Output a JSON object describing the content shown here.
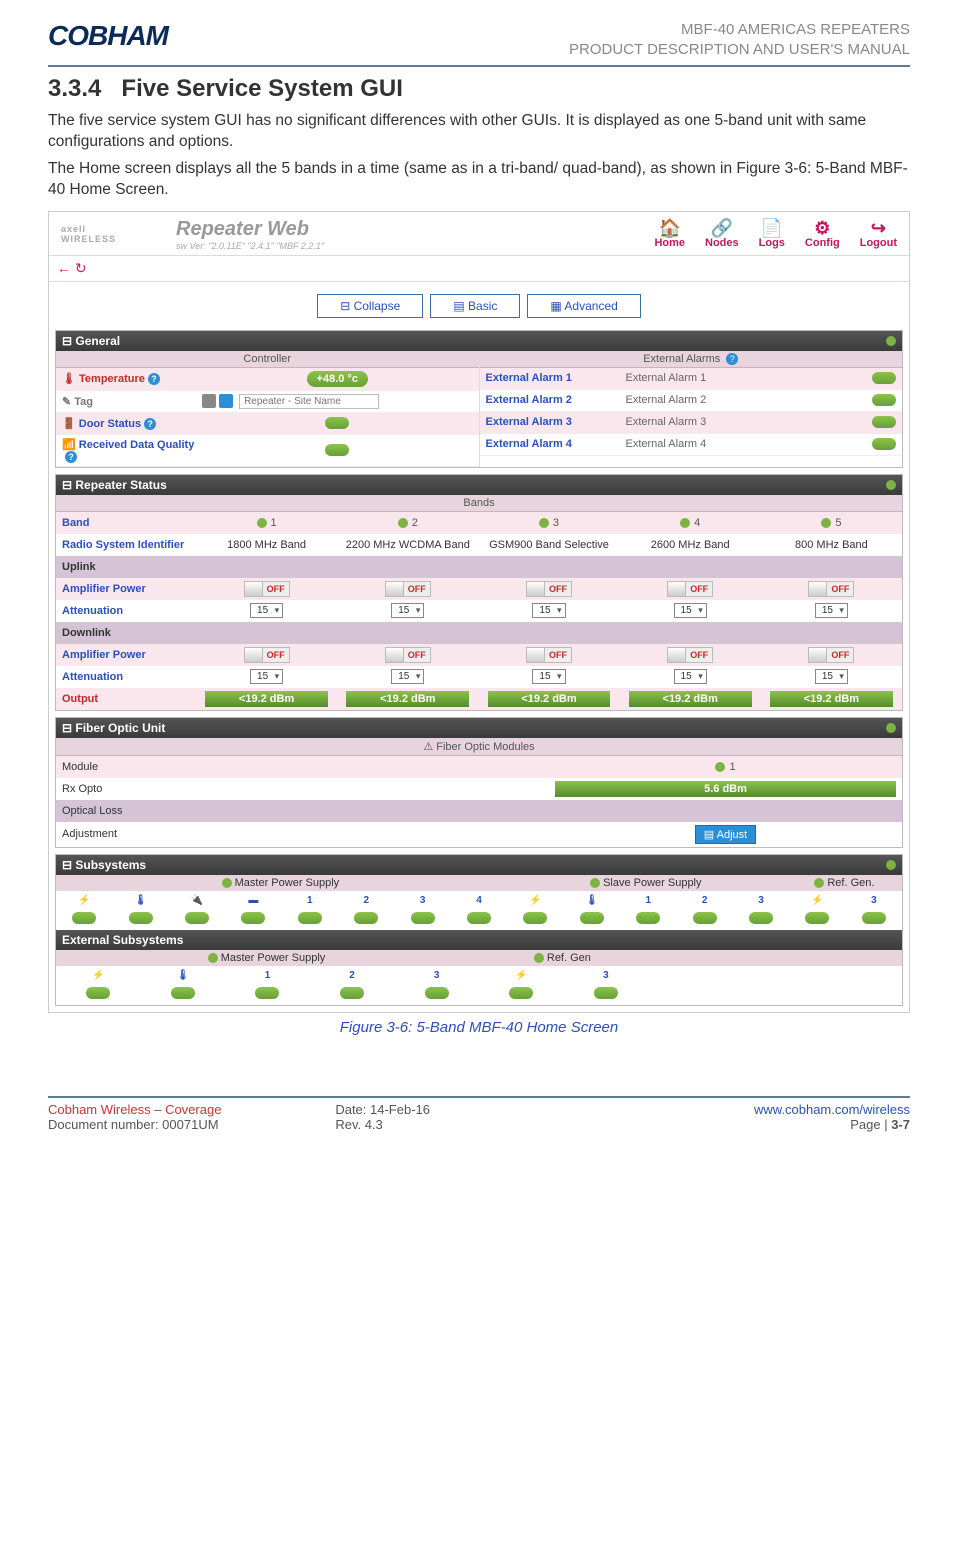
{
  "header": {
    "logo": "COBHAM",
    "line1": "MBF-40 AMERICAS REPEATERS",
    "line2": "PRODUCT DESCRIPTION AND USER'S MANUAL"
  },
  "section": {
    "heading_num": "3.3.4",
    "heading_text": "Five Service System GUI",
    "para1": "The five service system GUI has no significant differences with other GUIs. It is displayed as one 5-band unit with same configurations and options.",
    "para2": "The Home screen displays all the 5 bands in a time (same as in a tri-band/ quad-band), as shown in Figure 3-6:  5-Band MBF-40 Home Screen."
  },
  "screenshot": {
    "logo_main": "axell",
    "logo_sub": "WIRELESS",
    "title": "Repeater Web",
    "ver": "sw Ver: \"2.0.11E\" \"2.4.1\" \"MBF 2.2.1\"",
    "nav": [
      "Home",
      "Nodes",
      "Logs",
      "Config",
      "Logout"
    ],
    "nav_icons": [
      "🏠",
      "🔗",
      "📄",
      "⚙",
      "↪"
    ],
    "back": "←",
    "reload": "↻",
    "mode": {
      "collapse": "⊟ Collapse",
      "basic": "▤ Basic",
      "advanced": "▦ Advanced"
    },
    "general": {
      "title": "⊟ General",
      "controller_hdr": "Controller",
      "ext_alarms_hdr": "External Alarms",
      "rows_left": {
        "temp": "Temperature",
        "temp_val": "+48.0 °c",
        "tag": "Tag",
        "tag_ph": "Repeater - Site Name",
        "door": "Door Status",
        "rdq": "Received Data Quality"
      },
      "rows_right": {
        "e1_l": "External Alarm 1",
        "e1_v": "External Alarm 1",
        "e2_l": "External Alarm 2",
        "e2_v": "External Alarm 2",
        "e3_l": "External Alarm 3",
        "e3_v": "External Alarm 3",
        "e4_l": "External Alarm 4",
        "e4_v": "External Alarm 4"
      }
    },
    "repeater": {
      "title": "⊟ Repeater Status",
      "bands_hdr": "Bands",
      "labels": {
        "band": "Band",
        "rsi": "Radio System Identifier",
        "uplink": "Uplink",
        "amp": "Amplifier Power",
        "att": "Attenuation",
        "downlink": "Downlink",
        "out": "Output"
      },
      "band_nums": [
        "1",
        "2",
        "3",
        "4",
        "5"
      ],
      "band_names": [
        "1800 MHz Band",
        "2200 MHz WCDMA Band",
        "GSM900 Band Selective",
        "2600 MHz Band",
        "800 MHz Band"
      ],
      "off": "OFF",
      "att_val": "15",
      "out_val": "<19.2 dBm"
    },
    "fiber": {
      "title": "⊟ Fiber Optic Unit",
      "hdr": "⚠ Fiber Optic Modules",
      "module": "Module",
      "module_num": "1",
      "rx": "Rx Opto",
      "rx_val": "5.6 dBm",
      "loss": "Optical Loss",
      "adj": "Adjustment",
      "adj_btn": "▤ Adjust"
    },
    "subsystems": {
      "title": "⊟ Subsystems",
      "master": "Master Power Supply",
      "slave": "Slave Power Supply",
      "ref": "Ref. Gen.",
      "icons_master": [
        "⚡",
        "🌡",
        "🔌",
        "▬",
        "1",
        "2",
        "3",
        "4"
      ],
      "icons_slave": [
        "⚡",
        "🌡",
        "1",
        "2",
        "3"
      ],
      "icons_ref": [
        "⚡",
        "3"
      ],
      "ext_title": "External Subsystems",
      "ext_master": "Master Power Supply",
      "ext_ref": "Ref. Gen",
      "ext_icons_m": [
        "⚡",
        "🌡",
        "1",
        "2",
        "3"
      ],
      "ext_icons_r": [
        "⚡",
        "3"
      ]
    }
  },
  "caption": "Figure 3-6:  5-Band MBF-40 Home Screen",
  "footer": {
    "l1a": "Cobham Wireless",
    "l1b": " – ",
    "l1c": "Coverage",
    "m1": "Date: 14-Feb-16",
    "r1": "www.cobham.com/wireless",
    "l2": "Document number: 00071UM",
    "m2": "Rev. 4.3",
    "r2a": "Page | ",
    "r2b": "3-7"
  }
}
